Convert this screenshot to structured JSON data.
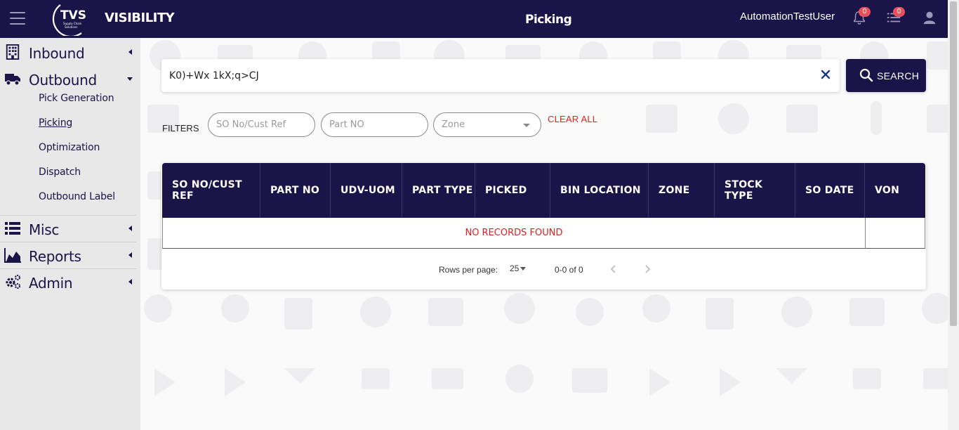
{
  "header": {
    "brand": "VISIBILITY",
    "logo_text": "TVS",
    "logo_subtext": "Supply Chain Solutions",
    "page_title": "Picking",
    "user": "AutomationTestUser",
    "notifications_count": "0",
    "tasks_count": "0",
    "color": "#1a1448"
  },
  "sidebar": {
    "inbound": "Inbound",
    "outbound": "Outbound",
    "outbound_items": [
      "Pick Generation",
      "Picking",
      "Optimization",
      "Dispatch",
      "Outbound Label"
    ],
    "active_item": "Picking",
    "misc": "Misc",
    "reports": "Reports",
    "admin": "Admin"
  },
  "search": {
    "value": "K0)+Wx 1kX;q>CJ",
    "button_label": "SEARCH"
  },
  "filters": {
    "label": "FILTERS",
    "so_placeholder": "SO No/Cust Ref",
    "part_placeholder": "Part NO",
    "zone_placeholder": "Zone",
    "clear_all": "CLEAR ALL"
  },
  "table": {
    "columns": [
      "SO NO/CUST REF",
      "PART NO",
      "UDV-UOM",
      "PART TYPE",
      "PICKED",
      "BIN LOCATION",
      "ZONE",
      "STOCK TYPE",
      "SO DATE",
      "VON"
    ],
    "empty_message": "NO RECORDS FOUND"
  },
  "pagination": {
    "rows_per_page_label": "Rows per page:",
    "rows_per_page": "25",
    "range": "0-0 of 0"
  }
}
